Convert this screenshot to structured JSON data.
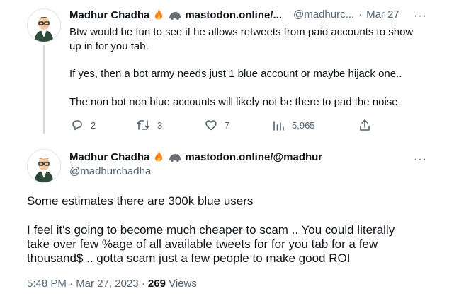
{
  "reply": {
    "author_name": "Madhur Chadha",
    "author_extra": "mastodon.online/...",
    "handle": "@madhurc...",
    "time_sep": "·",
    "time": "Mar 27",
    "more": "···",
    "lines": [
      "Btw would be fun to see if he allows retweets from paid accounts to show",
      "up in for you tab.",
      "If yes, then a bot army needs just 1 blue account or maybe hijack one..",
      "The non bot non blue accounts will likely not be there to pad the noise."
    ],
    "actions": {
      "replies": "2",
      "retweets": "3",
      "likes": "7",
      "views": "5,965"
    },
    "icons": [
      "fire-emoji-icon",
      "mastodon-icon",
      "reply-icon",
      "retweet-icon",
      "like-icon",
      "views-icon",
      "share-icon",
      "more-icon"
    ]
  },
  "main": {
    "author_name": "Madhur Chadha",
    "author_extra": "mastodon.online/@madhur",
    "handle": "@madhurchadha",
    "more": "···",
    "lines": [
      "Some estimates there are 300k blue users",
      "I feel it's going to become much cheaper to scam .. You could literally",
      "take over few %age of all available tweets for for you tab for a few",
      "thousand$ .. gotta scam just a few people to make good ROI"
    ],
    "timestamp": "5:48 PM · Mar 27, 2023 ·",
    "views_count": "269",
    "views_label": "Views"
  }
}
